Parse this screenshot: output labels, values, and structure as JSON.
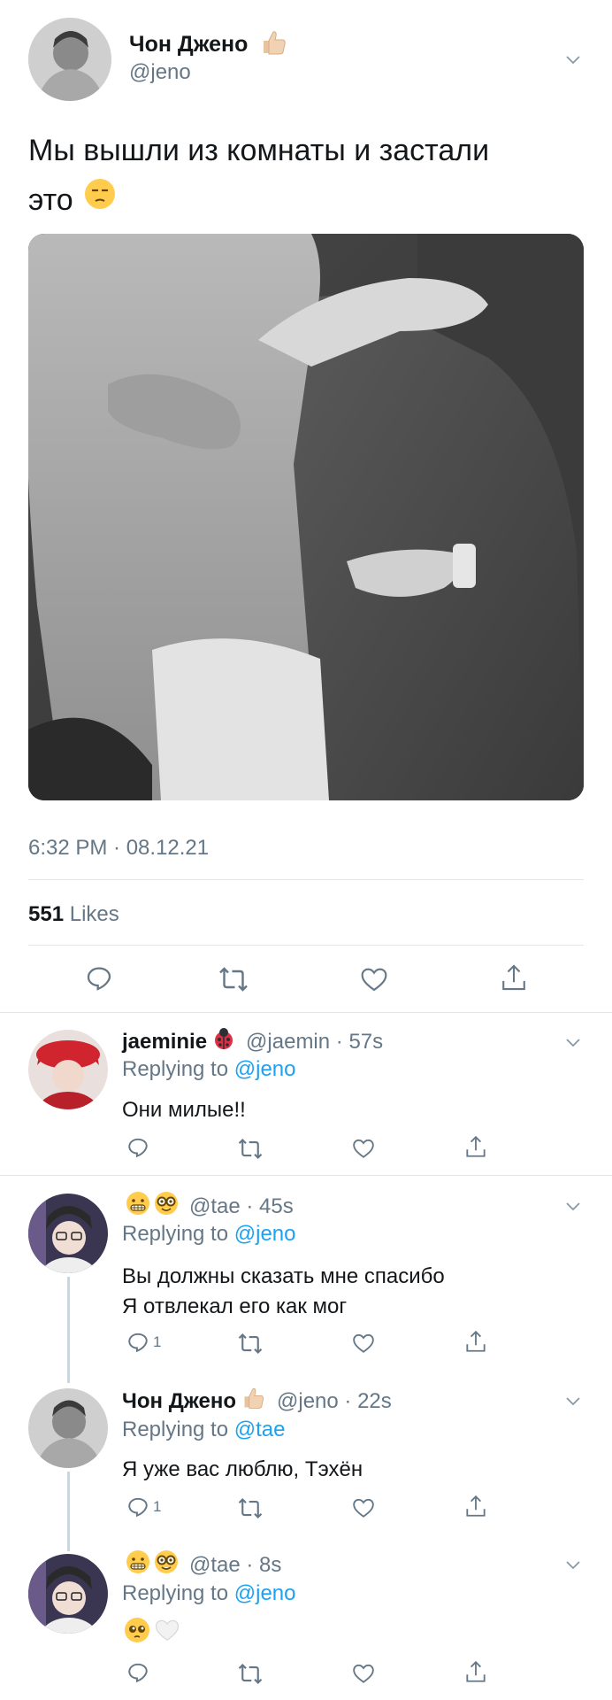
{
  "main_tweet": {
    "display_name": "Чон Джено",
    "handle": "@jeno",
    "text_line1": "Мы вышли из комнаты и застали",
    "text_line2": "это",
    "timestamp": "6:32 PM · 08.12.21",
    "likes_count": "551",
    "likes_label": "Likes"
  },
  "replies": [
    {
      "display_name": "jaeminie",
      "meta": "@jaemin · 57s",
      "replying_prefix": "Replying to",
      "replying_to": "@jeno",
      "text_lines": [
        "Они милые!!"
      ],
      "reply_count": ""
    },
    {
      "display_name": "",
      "meta": "@tae · 45s",
      "replying_prefix": "Replying to",
      "replying_to": "@jeno",
      "text_lines": [
        "Вы должны сказать мне спасибо",
        "Я отвлекал его как мог"
      ],
      "reply_count": "1"
    },
    {
      "display_name": "Чон Джено",
      "meta": "@jeno · 22s",
      "replying_prefix": "Replying to",
      "replying_to": "@tae",
      "text_lines": [
        "Я уже вас люблю, Тэхён"
      ],
      "reply_count": "1"
    },
    {
      "display_name": "",
      "meta": "@tae · 8s",
      "replying_prefix": "Replying to",
      "replying_to": "@jeno",
      "text_lines": [],
      "reply_count": ""
    }
  ],
  "colors": {
    "link_blue": "#1da1f2",
    "secondary_grey": "#657786",
    "divider": "#e1e8ed"
  },
  "icons": [
    "reply-icon",
    "retweet-icon",
    "like-icon",
    "share-icon",
    "chevron-down-icon"
  ]
}
